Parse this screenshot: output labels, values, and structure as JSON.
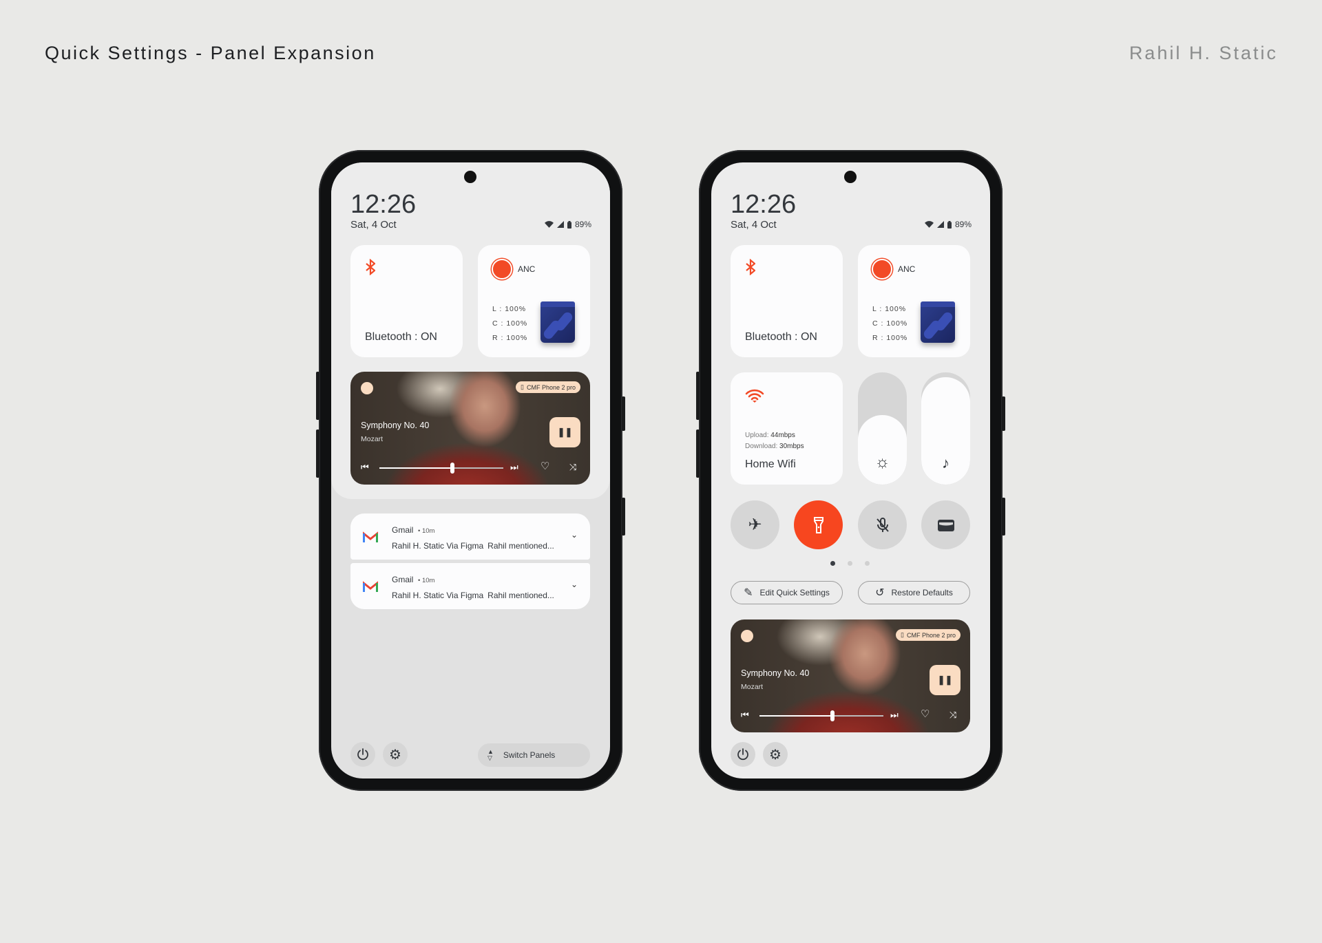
{
  "header": {
    "title": "Quick Settings - Panel Expansion",
    "author": "Rahil H. Static"
  },
  "status": {
    "time": "12:26",
    "date": "Sat, 4 Oct",
    "battery": "89%"
  },
  "bluetooth": {
    "label": "Bluetooth : ON"
  },
  "anc": {
    "label": "ANC",
    "levels": [
      "L : 100%",
      "C : 100%",
      "R : 100%"
    ]
  },
  "media": {
    "title": "Symphony No. 40",
    "artist": "Mozart",
    "device": "CMF Phone 2 pro",
    "progress": 0.57
  },
  "notifications": [
    {
      "app": "Gmail",
      "time": "10m",
      "sender": "Rahil H. Static Via Figma",
      "preview": "Rahil mentioned..."
    },
    {
      "app": "Gmail",
      "time": "10m",
      "sender": "Rahil H. Static Via Figma",
      "preview": "Rahil mentioned..."
    }
  ],
  "switch_panels": "Switch Panels",
  "wifi": {
    "upload_label": "Upload:",
    "upload": "44mbps",
    "download_label": "Download:",
    "download": "30mbps",
    "name": "Home Wifi"
  },
  "sliders": {
    "brightness": 0.62,
    "volume": 0.96
  },
  "buttons": {
    "edit": "Edit Quick Settings",
    "restore": "Restore Defaults"
  },
  "colors": {
    "accent": "#f7461f",
    "peach": "#fadcc2"
  }
}
